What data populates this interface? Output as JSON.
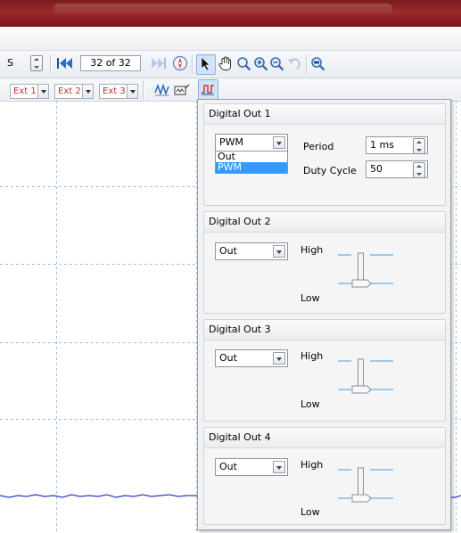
{
  "toolbar": {
    "unit_fragment": "S",
    "page_indicator": "32 of 32"
  },
  "trigger_bar": {
    "channels": [
      "Ext 1",
      "Ext 2",
      "Ext 3"
    ]
  },
  "digital_panel": {
    "groups": [
      {
        "title": "Digital Out 1",
        "mode": "PWM",
        "mode_options": [
          "Out",
          "PWM"
        ],
        "mode_options_open": true,
        "period_label": "Period",
        "period_value": "1 ms",
        "duty_label": "Duty Cycle",
        "duty_value": "50"
      },
      {
        "title": "Digital Out 2",
        "mode": "Out",
        "high_label": "High",
        "low_label": "Low",
        "state": "Low"
      },
      {
        "title": "Digital Out 3",
        "mode": "Out",
        "high_label": "High",
        "low_label": "Low",
        "state": "Low"
      },
      {
        "title": "Digital Out 4",
        "mode": "Out",
        "high_label": "High",
        "low_label": "Low",
        "state": "Low"
      }
    ]
  },
  "icons": {
    "toolbar1": [
      "spin-icon",
      "rewind-to-start-icon",
      "fast-forward-icon",
      "compass-icon",
      "pointer-icon",
      "hand-pan-icon",
      "zoom-icon",
      "zoom-in-icon",
      "zoom-out-icon",
      "undo-zoom-icon",
      "zoom-100-icon"
    ],
    "toolbar2": [
      "waveform-icon",
      "signal-generator-icon",
      "digital-out-icon"
    ]
  },
  "colors": {
    "title_bar": "#8b2123",
    "grid": "#9cc3e6",
    "signal_trace": "#2a3fbf",
    "selection": "#3399ff",
    "slider_line": "#7fb9ec"
  }
}
